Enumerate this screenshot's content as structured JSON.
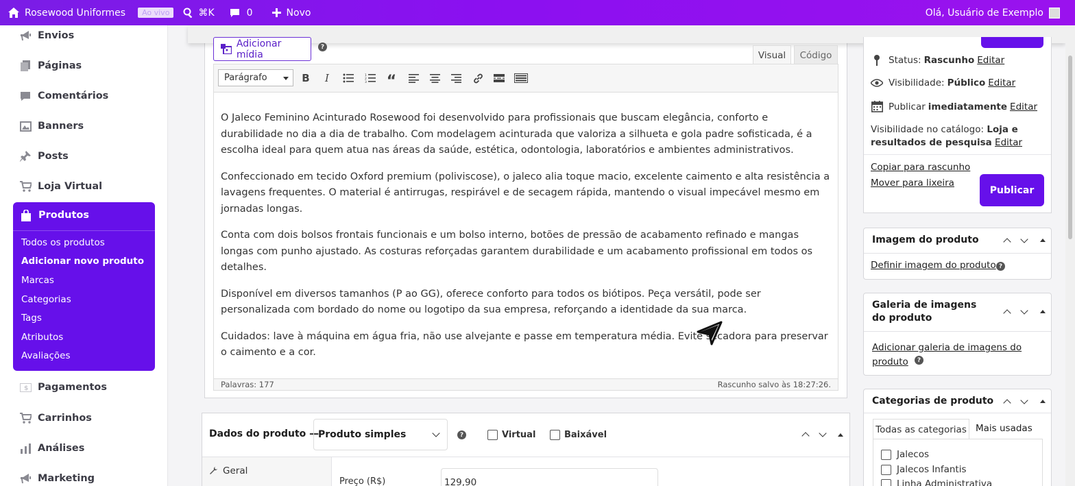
{
  "adminbar": {
    "site_name": "Rosewood Uniformes",
    "live_badge": "Ao vivo",
    "search_shortcut": "⌘K",
    "comments_count": "0",
    "new_label": "Novo",
    "greeting": "Olá, Usuário de Exemplo"
  },
  "sidebar": {
    "items": [
      {
        "label": "Envios",
        "icon": "megaphone-icon"
      },
      {
        "label": "Páginas",
        "icon": "pages-icon"
      },
      {
        "label": "Comentários",
        "icon": "comment-icon"
      },
      {
        "label": "Banners",
        "icon": "image-icon"
      },
      {
        "label": "Posts",
        "icon": "pin-icon"
      },
      {
        "label": "Loja Virtual",
        "icon": "cart-icon"
      }
    ],
    "products": {
      "label": "Produtos",
      "icon": "bag-icon",
      "subitems": [
        "Todos os produtos",
        "Adicionar novo produto",
        "Marcas",
        "Categorias",
        "Tags",
        "Atributos",
        "Avaliações"
      ]
    },
    "items_after": [
      {
        "label": "Pagamentos",
        "icon": "money-icon"
      },
      {
        "label": "Carrinhos",
        "icon": "cart-icon"
      },
      {
        "label": "Análises",
        "icon": "chart-icon"
      },
      {
        "label": "Marketing",
        "icon": "megaphone-icon"
      }
    ]
  },
  "editor": {
    "add_media": "Adicionar mídia",
    "tab_visual": "Visual",
    "tab_code": "Código",
    "format": "Parágrafo",
    "paragraphs": [
      "O Jaleco Feminino Acinturado Rosewood foi desenvolvido para profissionais que buscam elegância, conforto e durabilidade no dia a dia de trabalho. Com modelagem acinturada que valoriza a silhueta e gola padre sofisticada, é a escolha ideal para quem atua nas áreas da saúde, estética, odontologia, laboratórios e ambientes administrativos.",
      "Confeccionado em tecido Oxford premium (poliviscose), o jaleco alia toque macio, excelente caimento e alta resistência a lavagens frequentes. O material é antirrugas, respirável e de secagem rápida, mantendo o visual impecável mesmo em jornadas longas.",
      "Conta com dois bolsos frontais funcionais e um bolso interno, botões de pressão de acabamento refinado e mangas longas com punho ajustado. As costuras reforçadas garantem durabilidade e um acabamento profissional em todos os detalhes.",
      "Disponível em diversos tamanhos (P ao GG), oferece conforto para todos os biótipos. Peça versátil, pode ser personalizada com bordado do nome ou logotipo da sua empresa, reforçando a identidade da sua marca.",
      "Cuidados: lave à máquina em água fria, não use alvejante e passe em temperatura média. Evite secadora para preservar o caimento e a cor."
    ],
    "word_count": "Palavras: 177",
    "draft_saved": "Rascunho salvo às 18:27:26."
  },
  "product_data": {
    "title": "Dados do produto —",
    "type": "Produto simples",
    "virtual": "Virtual",
    "downloadable": "Baixável",
    "tab_general": "Geral",
    "price_label": "Preço (R$)",
    "price_value": "129,90"
  },
  "publish": {
    "status_label": "Status:",
    "status_value": "Rascunho",
    "visibility_label": "Visibilidade:",
    "visibility_value": "Público",
    "publish_label": "Publicar",
    "publish_value": "imediatamente",
    "catalog_label": "Visibilidade no catálogo:",
    "catalog_value": "Loja e resultados de pesquisa",
    "edit": "Editar",
    "copy_draft": "Copiar para rascunho",
    "move_trash": "Mover para lixeira",
    "publish_button": "Publicar"
  },
  "product_image": {
    "title": "Imagem do produto",
    "link": "Definir imagem do produto"
  },
  "gallery": {
    "title": "Galeria de imagens do produto",
    "link": "Adicionar galeria de imagens do produto"
  },
  "categories": {
    "title": "Categorias de produto",
    "tab_all": "Todas as categorias",
    "tab_most": "Mais usadas",
    "items": [
      "Jalecos",
      "Jalecos Infantis",
      "Linha Administrativa"
    ]
  },
  "colors": {
    "accent": "#6610ea",
    "adminbar": "#8b10f0"
  }
}
